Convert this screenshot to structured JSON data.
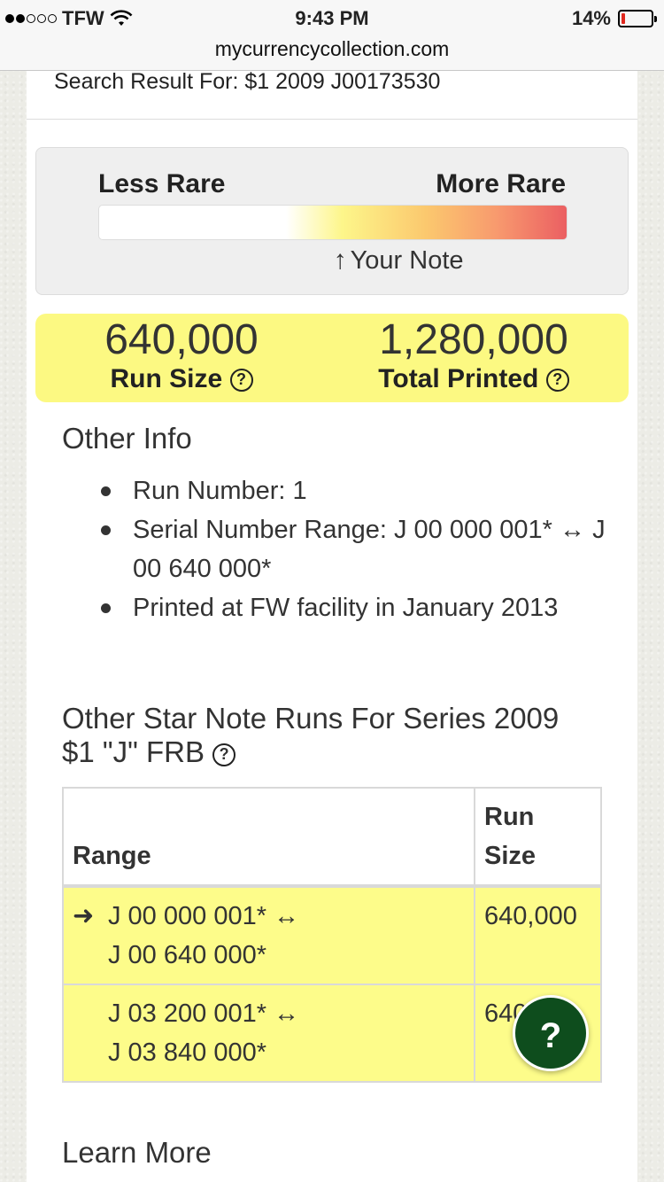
{
  "status_bar": {
    "carrier": "TFW",
    "time": "9:43 PM",
    "battery_percent": "14%",
    "battery_level": 0.14,
    "signal_bars_filled": 2,
    "signal_bars_total": 5
  },
  "browser": {
    "url": "mycurrencycollection.com"
  },
  "search": {
    "result_text": "Search Result For: $1 2009 J00173530"
  },
  "rarity": {
    "less_label": "Less Rare",
    "more_label": "More Rare",
    "your_note_label": "Your Note",
    "your_note_position": 0.52
  },
  "stats": {
    "run_size_value": "640,000",
    "run_size_label": "Run Size",
    "total_printed_value": "1,280,000",
    "total_printed_label": "Total Printed",
    "help_glyph": "?"
  },
  "other_info": {
    "title": "Other Info",
    "items": [
      "Run Number: 1",
      "Serial Number Range: J 00 000 001* ↔ J 00 640 000*",
      "Printed at FW facility in January 2013"
    ]
  },
  "star_runs": {
    "title": "Other Star Note Runs For Series 2009 $1 \"J\" FRB",
    "headers": {
      "range": "Range",
      "run_size": "Run Size"
    },
    "rows": [
      {
        "current": true,
        "range_line1": "J 00 000 001* ↔",
        "range_line2": "J 00 640 000*",
        "run_size": "640,000"
      },
      {
        "current": false,
        "range_line1": "J 03 200 001* ↔",
        "range_line2": "J 03 840 000*",
        "run_size": "640,000"
      }
    ]
  },
  "help_button": {
    "label": "?"
  },
  "learn_more": {
    "title": "Learn More"
  },
  "colors": {
    "highlight_yellow": "#fcf982",
    "help_button_green": "#0e4d1d",
    "battery_red": "#e0281e"
  }
}
